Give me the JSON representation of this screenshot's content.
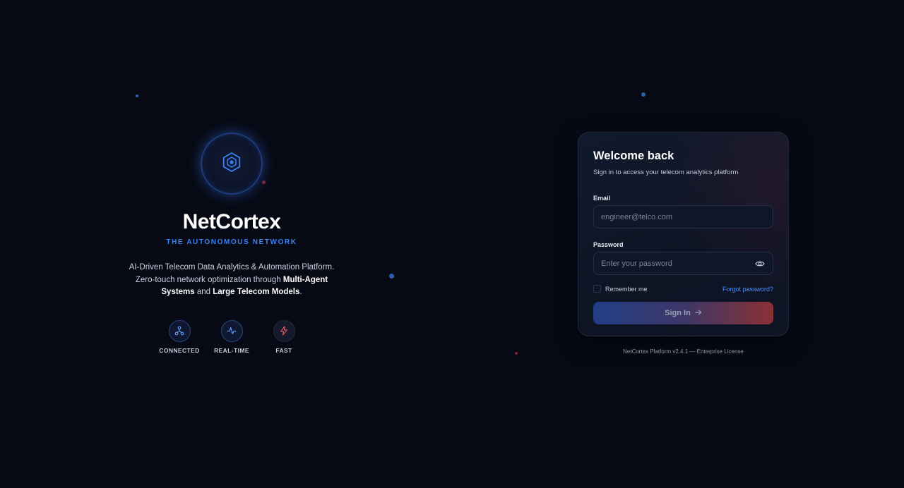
{
  "brand": {
    "name": "NetCortex",
    "tagline": "THE AUTONOMOUS NETWORK",
    "desc_line1": "AI-Driven Telecom Data Analytics & Automation Platform.",
    "desc_line2_pre": "Zero-touch network optimization through ",
    "desc_bold1": "Multi-Agent Systems",
    "desc_mid": " and ",
    "desc_bold2": "Large Telecom Models",
    "desc_end": ".",
    "logo_icon": "hexagon-icon"
  },
  "features": [
    {
      "label": "CONNECTED",
      "icon": "network-icon"
    },
    {
      "label": "REAL-TIME",
      "icon": "activity-icon"
    },
    {
      "label": "FAST",
      "icon": "lightning-icon"
    }
  ],
  "login": {
    "title": "Welcome back",
    "subtitle": "Sign in to access your telecom analytics platform",
    "email_label": "Email",
    "email_placeholder": "engineer@telco.com",
    "email_value": "",
    "password_label": "Password",
    "password_placeholder": "Enter your password",
    "password_value": "",
    "remember_label": "Remember me",
    "remember_checked": false,
    "forgot_label": "Forgot password?",
    "signin_label": "Sign In"
  },
  "footer": "NetCortex Platform v2.4.1 — Enterprise License",
  "colors": {
    "background": "#070a14",
    "accent_blue": "#3b82f6",
    "accent_red": "#8a3134"
  }
}
